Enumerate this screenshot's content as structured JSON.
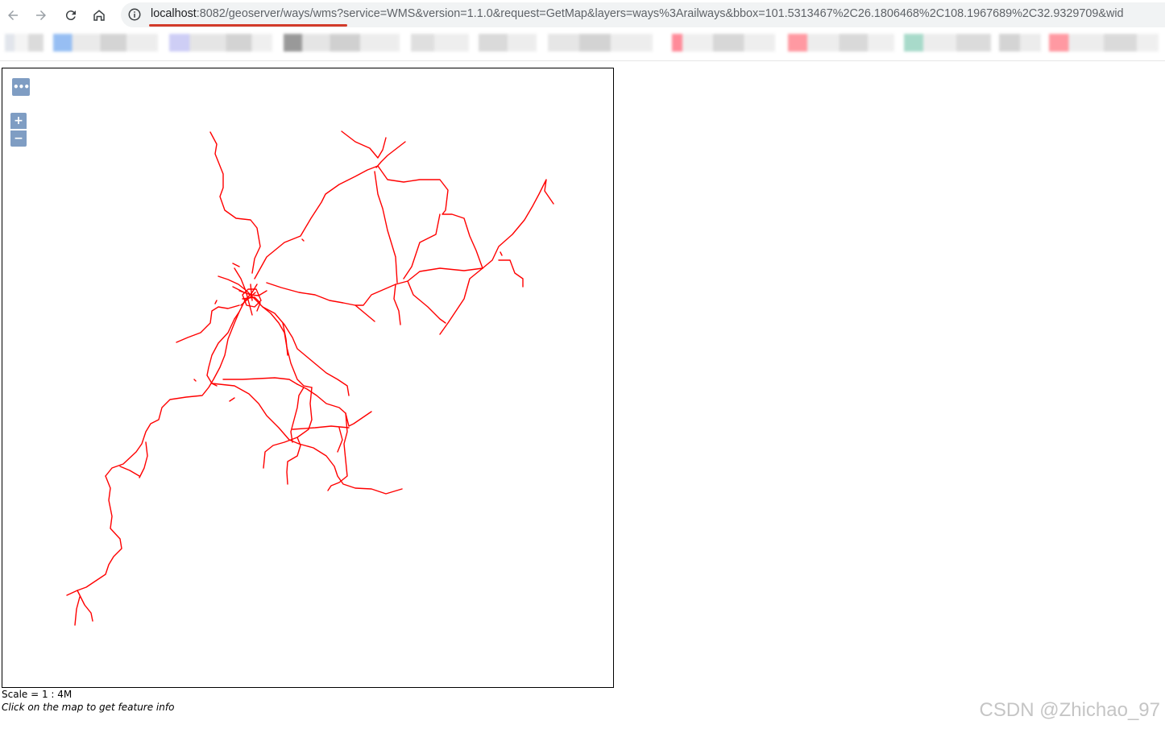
{
  "browser": {
    "url_host": "localhost",
    "url_rest": ":8082/geoserver/ways/wms?service=WMS&version=1.1.0&request=GetMap&layers=ways%3Arailways&bbox=101.5313467%2C26.1806468%2C108.1967689%2C32.9329709&wid",
    "bookmarks": [
      "bookmark-1",
      "bookmark-2",
      "bookmark-3",
      "bookmark-4",
      "bookmark-5",
      "bookmark-6",
      "bookmark-7",
      "bookmark-8",
      "bookmark-9",
      "bookmark-10",
      "bookmark-11",
      "bookmark-12"
    ]
  },
  "map": {
    "layer": "ways:railways",
    "line_color": "#ff0000",
    "controls": {
      "toggle_label": "•••",
      "zoom_in_label": "+",
      "zoom_out_label": "−"
    },
    "scale_text": "Scale = 1 : 4M",
    "hint_text": "Click on the map to get feature info"
  },
  "watermark": "CSDN @Zhichao_97",
  "colors": {
    "accent_underline": "#d23a2a",
    "omnibox_bg": "#f1f3f4",
    "control_bg": "rgba(0,60,136,0.5)"
  }
}
